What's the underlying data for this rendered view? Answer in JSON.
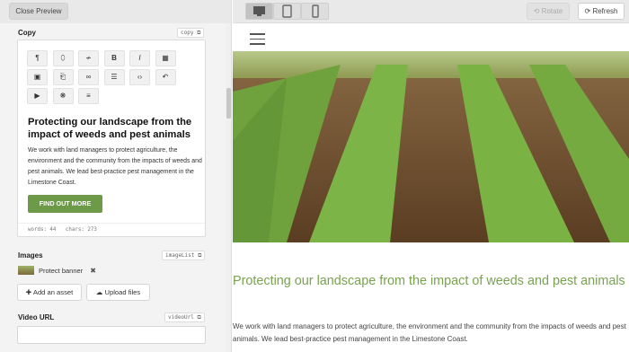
{
  "header": {
    "close_preview": "Close Preview",
    "rotate": "Rotate",
    "refresh": "Refresh"
  },
  "copy_section": {
    "label": "Copy",
    "tag": "copy",
    "heading": "Protecting our landscape from the impact of weeds and pest animals",
    "body": "We work with land managers to protect agriculture, the environment and the community from the impacts of weeds and pest animals. We lead best-practice pest management in the Limestone Coast.",
    "button": "FIND OUT MORE",
    "words": "words: 44",
    "chars": "chars: 273",
    "toolbar": [
      {
        "name": "paragraph-icon",
        "glyph": "¶"
      },
      {
        "name": "color-drop-icon",
        "glyph": "⬯"
      },
      {
        "name": "strikethrough-icon",
        "glyph": "≁"
      },
      {
        "name": "bold-icon",
        "glyph": "B"
      },
      {
        "name": "italic-icon",
        "glyph": "I"
      },
      {
        "name": "table-icon",
        "glyph": "▦"
      },
      {
        "name": "image-icon",
        "glyph": "▣"
      },
      {
        "name": "embed-icon",
        "glyph": "⎗"
      },
      {
        "name": "link-icon",
        "glyph": "∞"
      },
      {
        "name": "list-icon",
        "glyph": "☰"
      },
      {
        "name": "code-icon",
        "glyph": "‹›"
      },
      {
        "name": "undo-icon",
        "glyph": "↶"
      },
      {
        "name": "video-icon",
        "glyph": "▶"
      },
      {
        "name": "special-char-icon",
        "glyph": "❋"
      },
      {
        "name": "align-icon",
        "glyph": "≡"
      }
    ]
  },
  "images_section": {
    "label": "Images",
    "tag": "imageList",
    "asset_name": "Protect banner",
    "add_asset": "Add an asset",
    "upload_files": "Upload files"
  },
  "video_section": {
    "label": "Video URL",
    "tag": "videoUrl",
    "value": ""
  },
  "preview": {
    "heading": "Protecting our landscape from the impact of weeds and pest animals",
    "body": "We work with land managers to protect agriculture, the environment and the community from the impacts of weeds and pest animals. We lead best-practice pest management in the Limestone Coast."
  },
  "colors": {
    "accent_green": "#79a24f",
    "cta_green": "#6c9a48"
  }
}
